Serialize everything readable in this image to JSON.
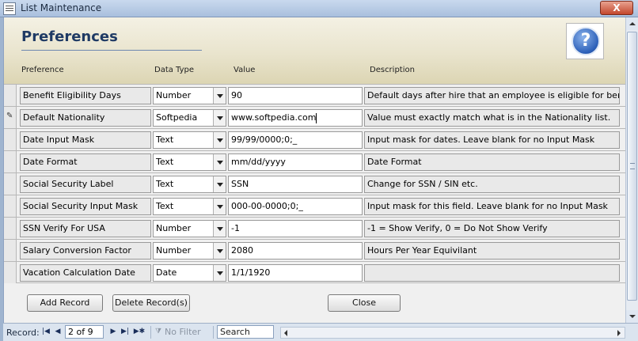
{
  "window": {
    "title": "List Maintenance",
    "close_label": "X"
  },
  "header": {
    "title": "Preferences",
    "help_label": "?",
    "columns": {
      "preference": "Preference",
      "data_type": "Data Type",
      "value": "Value",
      "description": "Description"
    }
  },
  "rows": [
    {
      "preference": "Benefit Eligibility Days",
      "data_type": "Number",
      "value": "90",
      "description": "Default days after hire that an employee is eligible for ber"
    },
    {
      "preference": "Default Nationality",
      "data_type": "Softpedia",
      "value": "www.softpedia.com",
      "description": "Value must exactly match what is in the Nationality list."
    },
    {
      "preference": "Date Input Mask",
      "data_type": "Text",
      "value": "99/99/0000;0;_",
      "description": "Input mask for dates. Leave blank for no Input Mask"
    },
    {
      "preference": "Date Format",
      "data_type": "Text",
      "value": "mm/dd/yyyy",
      "description": "Date Format"
    },
    {
      "preference": "Social Security Label",
      "data_type": "Text",
      "value": "SSN",
      "description": "Change for SSN / SIN etc."
    },
    {
      "preference": "Social Security Input Mask",
      "data_type": "Text",
      "value": "000-00-0000;0;_",
      "description": "Input mask for this field. Leave blank for no Input Mask"
    },
    {
      "preference": "SSN Verify For USA",
      "data_type": "Number",
      "value": "-1",
      "description": "-1 = Show Verify, 0 = Do Not Show Verify"
    },
    {
      "preference": "Salary Conversion Factor",
      "data_type": "Number",
      "value": "2080",
      "description": "Hours Per Year Equivilant"
    },
    {
      "preference": "Vacation Calculation Date",
      "data_type": "Date",
      "value": "1/1/1920",
      "description": ""
    }
  ],
  "buttons": {
    "add_record": "Add Record",
    "delete_records": "Delete Record(s)",
    "close": "Close"
  },
  "navigation": {
    "record_label": "Record:",
    "first": "|◀",
    "prev": "◀",
    "current": "2 of 9",
    "next": "▶",
    "last": "▶|",
    "new": "▶✱",
    "filter_label": "No Filter",
    "search_label": "Search"
  },
  "icons": {
    "app": "list-icon",
    "help": "question-mark-icon",
    "record_editing": "pencil-icon",
    "dropdown": "chevron-down-icon",
    "filter": "funnel-x-icon"
  },
  "colors": {
    "title_text": "#1f3a64",
    "help_blue": "#2b5fb8",
    "header_band": "#e9e4cd"
  }
}
